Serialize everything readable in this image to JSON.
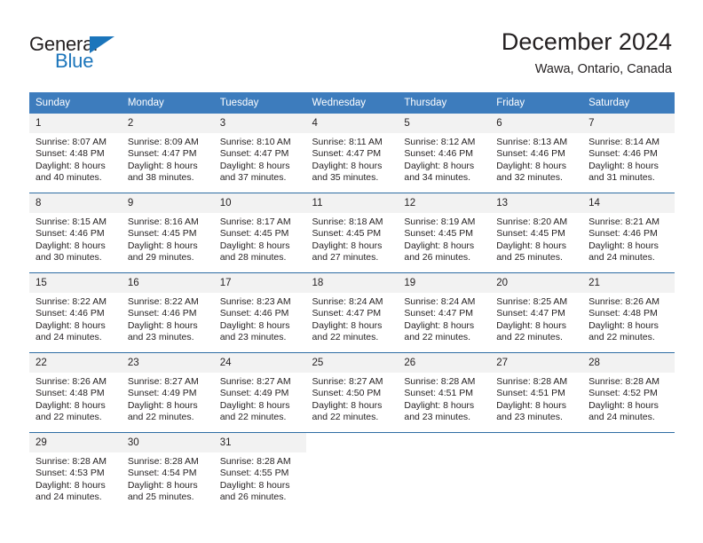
{
  "logo": {
    "word_top": "General",
    "word_bottom": "Blue",
    "accent_color": "#1b75bb"
  },
  "header": {
    "title": "December 2024",
    "location": "Wawa, Ontario, Canada"
  },
  "theme": {
    "header_row_bg": "#3d7cbd",
    "daynum_bg": "#f2f2f2",
    "grid_line": "#2e6da4",
    "text_color": "#231f20"
  },
  "weekday_headers": [
    "Sunday",
    "Monday",
    "Tuesday",
    "Wednesday",
    "Thursday",
    "Friday",
    "Saturday"
  ],
  "labels": {
    "sunrise_prefix": "Sunrise:",
    "sunset_prefix": "Sunset:",
    "daylight_prefix": "Daylight:"
  },
  "weeks": [
    [
      {
        "day": "1",
        "sunrise": "Sunrise: 8:07 AM",
        "sunset": "Sunset: 4:48 PM",
        "daylight_line1": "Daylight: 8 hours",
        "daylight_line2": "and 40 minutes."
      },
      {
        "day": "2",
        "sunrise": "Sunrise: 8:09 AM",
        "sunset": "Sunset: 4:47 PM",
        "daylight_line1": "Daylight: 8 hours",
        "daylight_line2": "and 38 minutes."
      },
      {
        "day": "3",
        "sunrise": "Sunrise: 8:10 AM",
        "sunset": "Sunset: 4:47 PM",
        "daylight_line1": "Daylight: 8 hours",
        "daylight_line2": "and 37 minutes."
      },
      {
        "day": "4",
        "sunrise": "Sunrise: 8:11 AM",
        "sunset": "Sunset: 4:47 PM",
        "daylight_line1": "Daylight: 8 hours",
        "daylight_line2": "and 35 minutes."
      },
      {
        "day": "5",
        "sunrise": "Sunrise: 8:12 AM",
        "sunset": "Sunset: 4:46 PM",
        "daylight_line1": "Daylight: 8 hours",
        "daylight_line2": "and 34 minutes."
      },
      {
        "day": "6",
        "sunrise": "Sunrise: 8:13 AM",
        "sunset": "Sunset: 4:46 PM",
        "daylight_line1": "Daylight: 8 hours",
        "daylight_line2": "and 32 minutes."
      },
      {
        "day": "7",
        "sunrise": "Sunrise: 8:14 AM",
        "sunset": "Sunset: 4:46 PM",
        "daylight_line1": "Daylight: 8 hours",
        "daylight_line2": "and 31 minutes."
      }
    ],
    [
      {
        "day": "8",
        "sunrise": "Sunrise: 8:15 AM",
        "sunset": "Sunset: 4:46 PM",
        "daylight_line1": "Daylight: 8 hours",
        "daylight_line2": "and 30 minutes."
      },
      {
        "day": "9",
        "sunrise": "Sunrise: 8:16 AM",
        "sunset": "Sunset: 4:45 PM",
        "daylight_line1": "Daylight: 8 hours",
        "daylight_line2": "and 29 minutes."
      },
      {
        "day": "10",
        "sunrise": "Sunrise: 8:17 AM",
        "sunset": "Sunset: 4:45 PM",
        "daylight_line1": "Daylight: 8 hours",
        "daylight_line2": "and 28 minutes."
      },
      {
        "day": "11",
        "sunrise": "Sunrise: 8:18 AM",
        "sunset": "Sunset: 4:45 PM",
        "daylight_line1": "Daylight: 8 hours",
        "daylight_line2": "and 27 minutes."
      },
      {
        "day": "12",
        "sunrise": "Sunrise: 8:19 AM",
        "sunset": "Sunset: 4:45 PM",
        "daylight_line1": "Daylight: 8 hours",
        "daylight_line2": "and 26 minutes."
      },
      {
        "day": "13",
        "sunrise": "Sunrise: 8:20 AM",
        "sunset": "Sunset: 4:45 PM",
        "daylight_line1": "Daylight: 8 hours",
        "daylight_line2": "and 25 minutes."
      },
      {
        "day": "14",
        "sunrise": "Sunrise: 8:21 AM",
        "sunset": "Sunset: 4:46 PM",
        "daylight_line1": "Daylight: 8 hours",
        "daylight_line2": "and 24 minutes."
      }
    ],
    [
      {
        "day": "15",
        "sunrise": "Sunrise: 8:22 AM",
        "sunset": "Sunset: 4:46 PM",
        "daylight_line1": "Daylight: 8 hours",
        "daylight_line2": "and 24 minutes."
      },
      {
        "day": "16",
        "sunrise": "Sunrise: 8:22 AM",
        "sunset": "Sunset: 4:46 PM",
        "daylight_line1": "Daylight: 8 hours",
        "daylight_line2": "and 23 minutes."
      },
      {
        "day": "17",
        "sunrise": "Sunrise: 8:23 AM",
        "sunset": "Sunset: 4:46 PM",
        "daylight_line1": "Daylight: 8 hours",
        "daylight_line2": "and 23 minutes."
      },
      {
        "day": "18",
        "sunrise": "Sunrise: 8:24 AM",
        "sunset": "Sunset: 4:47 PM",
        "daylight_line1": "Daylight: 8 hours",
        "daylight_line2": "and 22 minutes."
      },
      {
        "day": "19",
        "sunrise": "Sunrise: 8:24 AM",
        "sunset": "Sunset: 4:47 PM",
        "daylight_line1": "Daylight: 8 hours",
        "daylight_line2": "and 22 minutes."
      },
      {
        "day": "20",
        "sunrise": "Sunrise: 8:25 AM",
        "sunset": "Sunset: 4:47 PM",
        "daylight_line1": "Daylight: 8 hours",
        "daylight_line2": "and 22 minutes."
      },
      {
        "day": "21",
        "sunrise": "Sunrise: 8:26 AM",
        "sunset": "Sunset: 4:48 PM",
        "daylight_line1": "Daylight: 8 hours",
        "daylight_line2": "and 22 minutes."
      }
    ],
    [
      {
        "day": "22",
        "sunrise": "Sunrise: 8:26 AM",
        "sunset": "Sunset: 4:48 PM",
        "daylight_line1": "Daylight: 8 hours",
        "daylight_line2": "and 22 minutes."
      },
      {
        "day": "23",
        "sunrise": "Sunrise: 8:27 AM",
        "sunset": "Sunset: 4:49 PM",
        "daylight_line1": "Daylight: 8 hours",
        "daylight_line2": "and 22 minutes."
      },
      {
        "day": "24",
        "sunrise": "Sunrise: 8:27 AM",
        "sunset": "Sunset: 4:49 PM",
        "daylight_line1": "Daylight: 8 hours",
        "daylight_line2": "and 22 minutes."
      },
      {
        "day": "25",
        "sunrise": "Sunrise: 8:27 AM",
        "sunset": "Sunset: 4:50 PM",
        "daylight_line1": "Daylight: 8 hours",
        "daylight_line2": "and 22 minutes."
      },
      {
        "day": "26",
        "sunrise": "Sunrise: 8:28 AM",
        "sunset": "Sunset: 4:51 PM",
        "daylight_line1": "Daylight: 8 hours",
        "daylight_line2": "and 23 minutes."
      },
      {
        "day": "27",
        "sunrise": "Sunrise: 8:28 AM",
        "sunset": "Sunset: 4:51 PM",
        "daylight_line1": "Daylight: 8 hours",
        "daylight_line2": "and 23 minutes."
      },
      {
        "day": "28",
        "sunrise": "Sunrise: 8:28 AM",
        "sunset": "Sunset: 4:52 PM",
        "daylight_line1": "Daylight: 8 hours",
        "daylight_line2": "and 24 minutes."
      }
    ],
    [
      {
        "day": "29",
        "sunrise": "Sunrise: 8:28 AM",
        "sunset": "Sunset: 4:53 PM",
        "daylight_line1": "Daylight: 8 hours",
        "daylight_line2": "and 24 minutes."
      },
      {
        "day": "30",
        "sunrise": "Sunrise: 8:28 AM",
        "sunset": "Sunset: 4:54 PM",
        "daylight_line1": "Daylight: 8 hours",
        "daylight_line2": "and 25 minutes."
      },
      {
        "day": "31",
        "sunrise": "Sunrise: 8:28 AM",
        "sunset": "Sunset: 4:55 PM",
        "daylight_line1": "Daylight: 8 hours",
        "daylight_line2": "and 26 minutes."
      },
      {
        "day": "",
        "sunrise": "",
        "sunset": "",
        "daylight_line1": "",
        "daylight_line2": ""
      },
      {
        "day": "",
        "sunrise": "",
        "sunset": "",
        "daylight_line1": "",
        "daylight_line2": ""
      },
      {
        "day": "",
        "sunrise": "",
        "sunset": "",
        "daylight_line1": "",
        "daylight_line2": ""
      },
      {
        "day": "",
        "sunrise": "",
        "sunset": "",
        "daylight_line1": "",
        "daylight_line2": ""
      }
    ]
  ]
}
